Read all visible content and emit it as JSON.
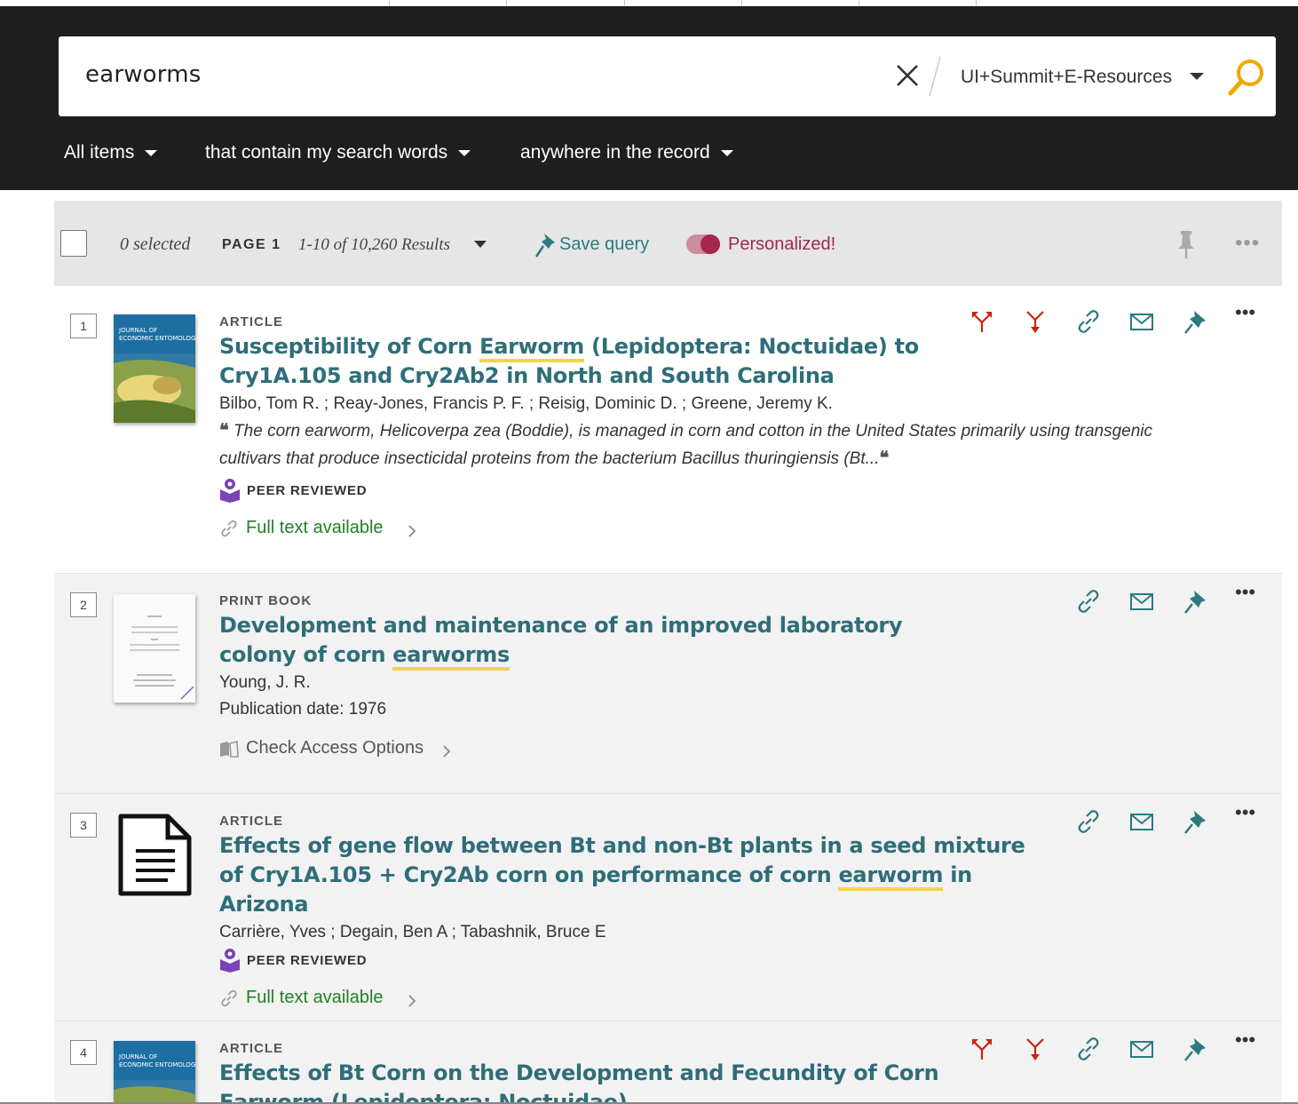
{
  "search": {
    "query": "earworms",
    "scope": "UI+Summit+E-Resources"
  },
  "filters": [
    {
      "label": "All items"
    },
    {
      "label": "that contain my search words"
    },
    {
      "label": "anywhere in the record"
    }
  ],
  "toolbar": {
    "selected": "0 selected",
    "page": "PAGE 1",
    "results": "1-10 of 10,260 Results",
    "save_query": "Save query",
    "personalized": "Personalized!"
  },
  "results": [
    {
      "num": "1",
      "type": "ARTICLE",
      "title_parts": [
        "Susceptibility of Corn ",
        "Earworm",
        " (Lepidoptera: Noctuidae) to Cry1A.105 and Cry2Ab2 in North and South Carolina"
      ],
      "authors": "Bilbo, Tom R. ; Reay-Jones, Francis P. F. ; Reisig, Dominic D. ; Greene, Jeremy K.",
      "snippet": "The corn earworm, Helicoverpa zea (Boddie), is managed in corn and cotton in the United States primarily using transgenic cultivars that produce insecticidal proteins from the bacterium Bacillus thuringiensis (Bt...",
      "peer": "PEER REVIEWED",
      "access": "Full text available"
    },
    {
      "num": "2",
      "type": "PRINT BOOK",
      "title_parts": [
        "Development and maintenance of an improved laboratory colony of corn ",
        "earworms",
        ""
      ],
      "authors": "Young, J. R.",
      "pubdate": "Publication date: 1976",
      "access": "Check Access Options"
    },
    {
      "num": "3",
      "type": "ARTICLE",
      "title_parts": [
        "Effects of gene flow between Bt and non-Bt plants in a seed mixture of Cry1A.105 + Cry2Ab corn on performance of corn ",
        "earworm",
        " in Arizona"
      ],
      "authors": "Carrière, Yves ; Degain, Ben A ; Tabashnik, Bruce E",
      "peer": "PEER REVIEWED",
      "access": "Full text available"
    },
    {
      "num": "4",
      "type": "ARTICLE",
      "title_parts": [
        "Effects of Bt Corn on the Development and Fecundity of Corn ",
        "Earworm",
        " (Lepidoptera: Noctuidae)"
      ]
    }
  ],
  "colors": {
    "header_bg": "#1e1e1e",
    "title_link": "#2e6e79",
    "highlight": "#f3d44b",
    "full_text": "#228022",
    "personalized": "#9c2a4a",
    "action_red": "#c4260b",
    "action_teal": "#2c7a7f"
  },
  "icons": {
    "clear": "close-icon",
    "search": "search-icon",
    "pin": "pin-icon",
    "link": "link-icon",
    "mail": "mail-icon",
    "cited_by": "citation-trail-icon",
    "citing": "citation-trail-down-icon",
    "more": "more-icon",
    "peer": "peer-reviewed-icon"
  }
}
